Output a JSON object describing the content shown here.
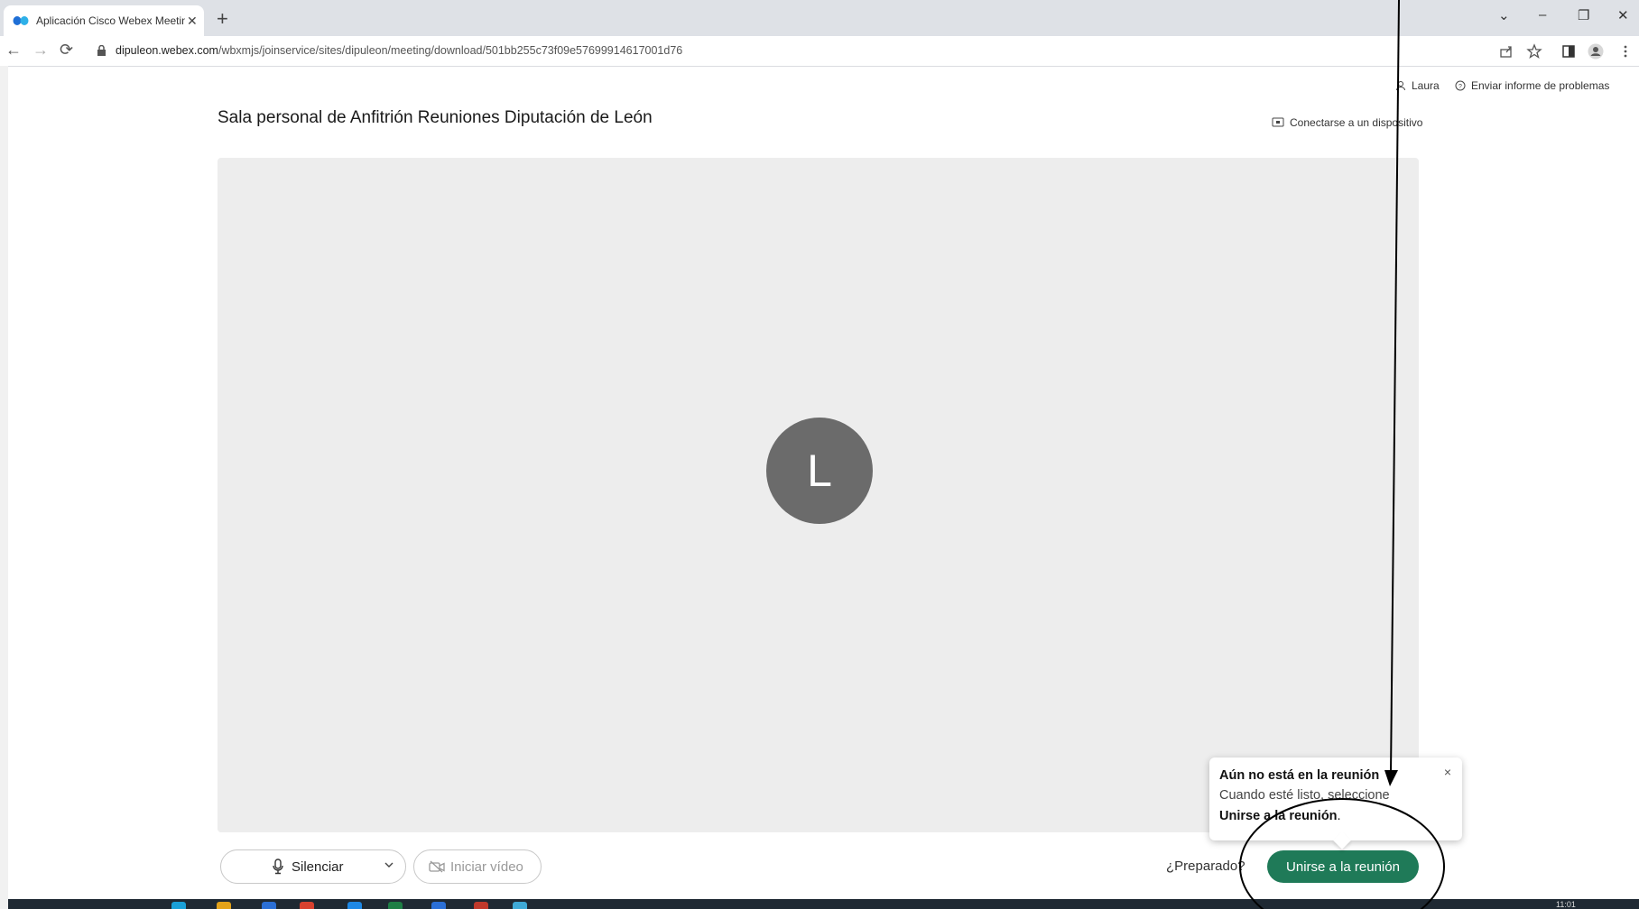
{
  "browser": {
    "tab_title": "Aplicación Cisco Webex Meeting",
    "tab_close": "✕",
    "new_tab": "+",
    "url_host": "dipuleon.webex.com",
    "url_path": "/wbxmjs/joinservice/sites/dipuleon/meeting/download/501bb255c73f09e57699914617001d76",
    "window_controls": {
      "dropdown": "⌄",
      "minimize": "–",
      "restore": "❐",
      "close": "✕"
    },
    "nav": {
      "back": "←",
      "forward": "→",
      "reload": "⟳"
    }
  },
  "header": {
    "user_name": "Laura",
    "report_link": "Enviar informe de problemas",
    "connect_device": "Conectarse a un dispositivo"
  },
  "meeting": {
    "room_title": "Sala personal de Anfitrión Reuniones Diputación de León",
    "avatar_initial": "L"
  },
  "controls": {
    "mute_label": "Silenciar",
    "video_label": "Iniciar vídeo",
    "ready_text": "¿Preparado?",
    "join_label": "Unirse a la reunión"
  },
  "tooltip": {
    "heading": "Aún no está en la reunión",
    "line1": "Cuando esté listo, seleccione",
    "line2_bold": "Unirse a la reunión",
    "line2_end": ".",
    "close": "×"
  },
  "taskbar": {
    "clock": "11:01"
  },
  "colors": {
    "join_button": "#1f7a58",
    "avatar": "#6b6b6b",
    "preview_bg": "#ededed"
  }
}
